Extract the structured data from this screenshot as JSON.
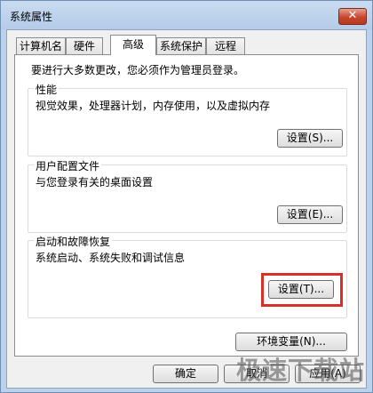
{
  "window": {
    "title": "系统属性",
    "close_label": "✕"
  },
  "tabs": [
    {
      "label": "计算机名"
    },
    {
      "label": "硬件"
    },
    {
      "label": "高级",
      "active": true
    },
    {
      "label": "系统保护"
    },
    {
      "label": "远程"
    }
  ],
  "admin_note": "要进行大多数更改，您必须作为管理员登录。",
  "groups": {
    "performance": {
      "title": "性能",
      "desc": "视觉效果，处理器计划，内存使用，以及虚拟内存",
      "button": "设置(S)..."
    },
    "user_profiles": {
      "title": "用户配置文件",
      "desc": "与您登录有关的桌面设置",
      "button": "设置(E)..."
    },
    "startup_recovery": {
      "title": "启动和故障恢复",
      "desc": "系统启动、系统失败和调试信息",
      "button": "设置(T)..."
    }
  },
  "env_button": "环境变量(N)...",
  "footer": {
    "ok": "确定",
    "cancel": "取消",
    "apply": "应用(A)"
  },
  "watermark": "极速下载站",
  "colors": {
    "highlight": "#d9302a",
    "titlebar": "#bcd1ea"
  }
}
